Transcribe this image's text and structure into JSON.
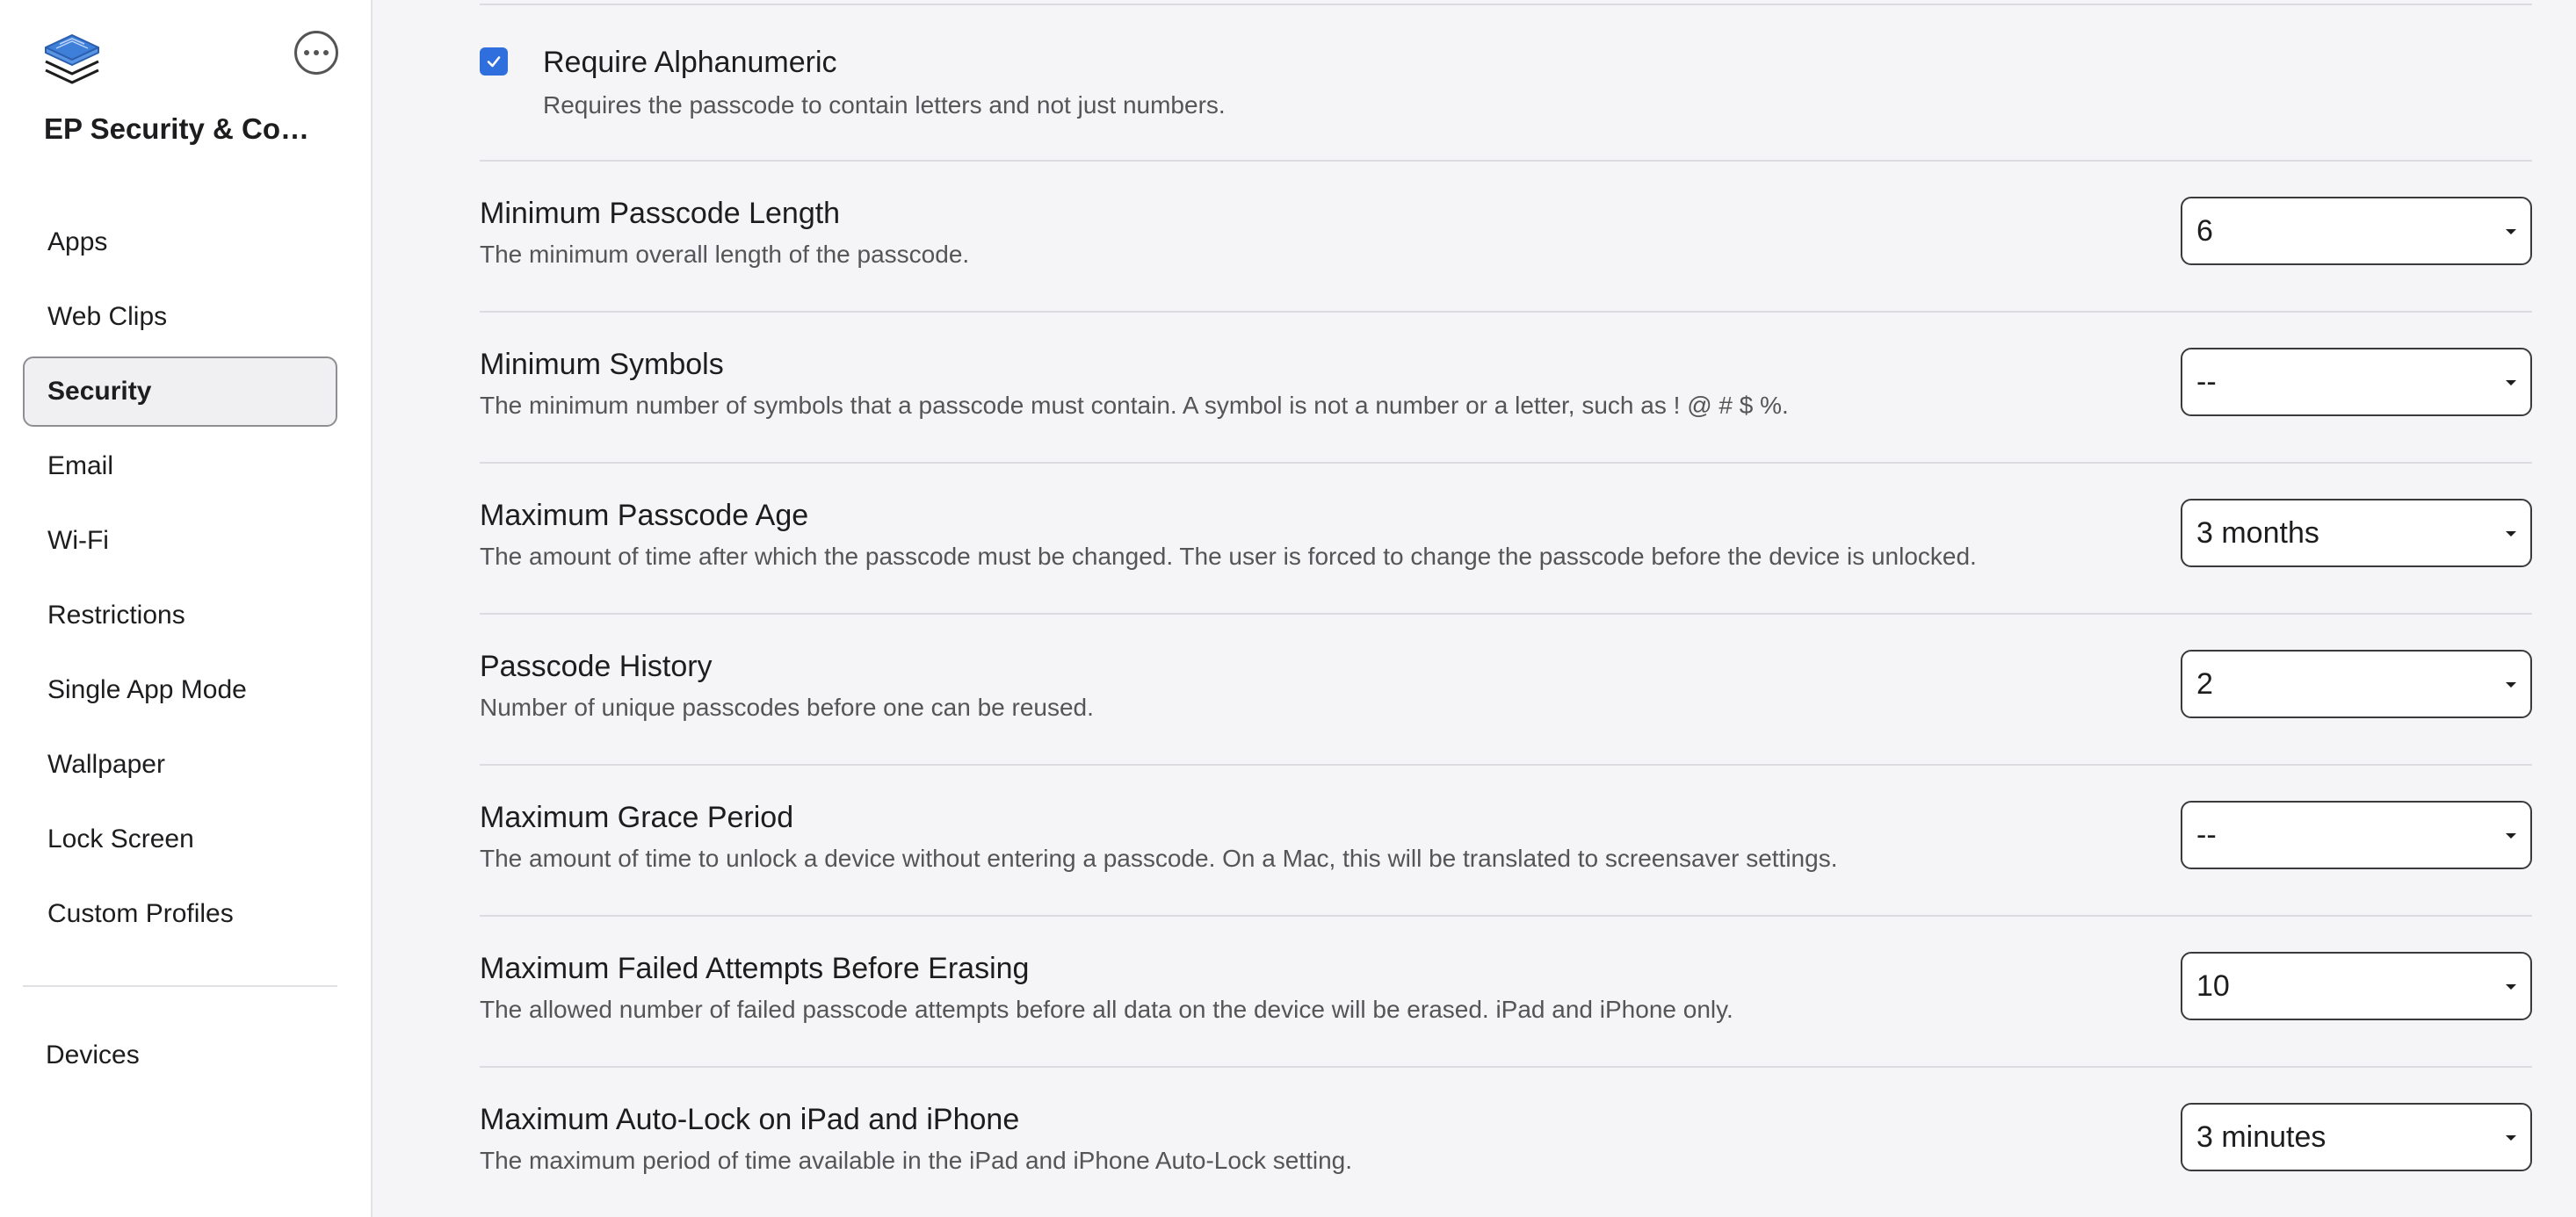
{
  "sidebar": {
    "app_title": "EP Security & Compliance",
    "items": [
      {
        "label": "Apps",
        "name": "apps"
      },
      {
        "label": "Web Clips",
        "name": "web-clips"
      },
      {
        "label": "Security",
        "name": "security",
        "active": true
      },
      {
        "label": "Email",
        "name": "email"
      },
      {
        "label": "Wi-Fi",
        "name": "wi-fi"
      },
      {
        "label": "Restrictions",
        "name": "restrictions"
      },
      {
        "label": "Single App Mode",
        "name": "single-app-mode"
      },
      {
        "label": "Wallpaper",
        "name": "wallpaper"
      },
      {
        "label": "Lock Screen",
        "name": "lock-screen"
      },
      {
        "label": "Custom Profiles",
        "name": "custom-profiles"
      }
    ],
    "devices_label": "Devices",
    "logo_icon": "stacked-layers-icon",
    "more_icon": "ellipsis-circle-icon"
  },
  "main": {
    "require_alphanumeric": {
      "checked": true,
      "title": "Require Alphanumeric",
      "description": "Requires the passcode to contain letters and not just numbers."
    },
    "settings": [
      {
        "title": "Minimum Passcode Length",
        "description": "The minimum overall length of the passcode.",
        "value": "6"
      },
      {
        "title": "Minimum Symbols",
        "description": "The minimum number of symbols that a passcode must contain. A symbol is not a number or a letter, such as ! @ # $ %.",
        "value": "--"
      },
      {
        "title": "Maximum Passcode Age",
        "description": "The amount of time after which the passcode must be changed. The user is forced to change the passcode before the device is unlocked.",
        "value": "3 months"
      },
      {
        "title": "Passcode History",
        "description": "Number of unique passcodes before one can be reused.",
        "value": "2"
      },
      {
        "title": "Maximum Grace Period",
        "description": "The amount of time to unlock a device without entering a passcode. On a Mac, this will be translated to screensaver settings.",
        "value": "--"
      },
      {
        "title": "Maximum Failed Attempts Before Erasing",
        "description": "The allowed number of failed passcode attempts before all data on the device will be erased. iPad and iPhone only.",
        "value": "10"
      },
      {
        "title": "Maximum Auto-Lock on iPad and iPhone",
        "description": "The maximum period of time available in the iPad and iPhone Auto-Lock setting.",
        "value": "3 minutes"
      }
    ]
  },
  "colors": {
    "accent": "#2f6fdd",
    "sidebar_bg": "#ffffff",
    "content_bg": "#f5f5f7"
  }
}
